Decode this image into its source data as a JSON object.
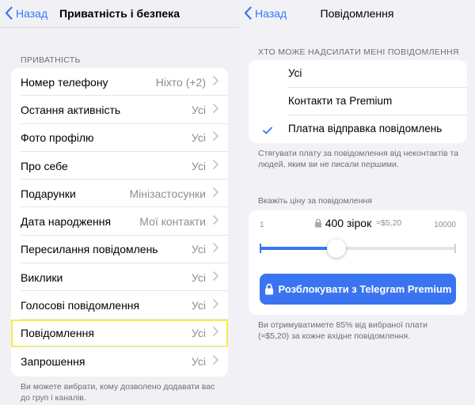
{
  "left": {
    "back_label": "Назад",
    "title": "Приватність і безпека",
    "section_header": "ПРИВАТНІСТЬ",
    "rows": [
      {
        "label": "Номер телефону",
        "value": "Ніхто (+2)"
      },
      {
        "label": "Остання активність",
        "value": "Усі"
      },
      {
        "label": "Фото профілю",
        "value": "Усі"
      },
      {
        "label": "Про себе",
        "value": "Усі"
      },
      {
        "label": "Подарунки",
        "value": "Мінізастосунки"
      },
      {
        "label": "Дата народження",
        "value": "Мої контакти"
      },
      {
        "label": "Пересилання повідомлень",
        "value": "Усі"
      },
      {
        "label": "Виклики",
        "value": "Усі"
      },
      {
        "label": "Голосові повідомлення",
        "value": "Усі"
      },
      {
        "label": "Повідомлення",
        "value": "Усі"
      },
      {
        "label": "Запрошення",
        "value": "Усі"
      }
    ],
    "footer": "Ви можете вибрати, кому дозволено додавати вас до груп і каналів."
  },
  "right": {
    "back_label": "Назад",
    "title": "Повідомлення",
    "section_header": "ХТО МОЖЕ НАДСИЛАТИ МЕНІ ПОВІДОМЛЕННЯ",
    "options": [
      {
        "label": "Усі",
        "selected": false
      },
      {
        "label": "Контакти та Premium",
        "selected": false
      },
      {
        "label": "Платна відправка повідомлень",
        "selected": true
      }
    ],
    "options_footer": "Стягувати плату за повідомлення від неконтактів та людей, яким ви не писали першими.",
    "price_header": "Вкажіть ціну за повідомлення",
    "price": {
      "min": "1",
      "max": "10000",
      "stars": "400 зірок",
      "usd": "≈$5,20",
      "fraction": 0.39
    },
    "unlock_label": "Розблокувати з Telegram Premium",
    "price_footer": "Ви отримуватимете 85% від вибраної плати (≈$5,20) за кожне вхідне повідомлення."
  },
  "colors": {
    "accent": "#3478f6",
    "highlight": "#f3ef4a"
  }
}
